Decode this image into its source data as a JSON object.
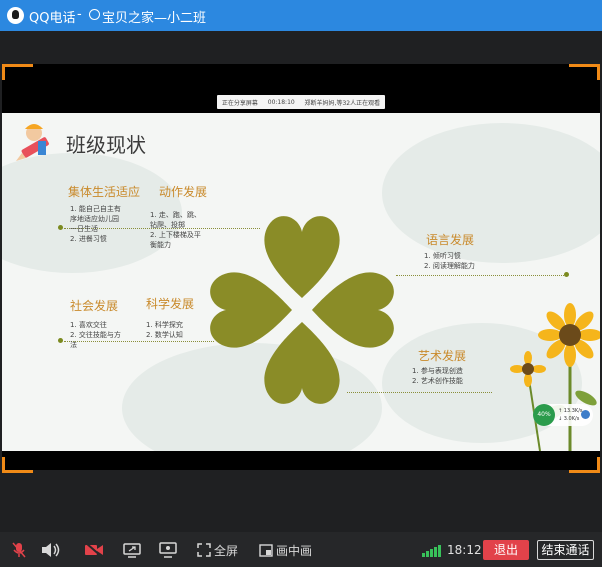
{
  "titlebar": {
    "app_name": "QQ电话",
    "separator": "-",
    "group_name": "宝贝之家—小二班"
  },
  "share_bar": {
    "status": "正在分享屏幕",
    "duration": "00:18:10",
    "viewers": "郑断羊妈妈,等32人正在观看"
  },
  "slide": {
    "title": "班级现状",
    "sections": {
      "collective": {
        "heading": "集体生活适应",
        "items": [
          "1. 能自己自主有",
          "序地适应幼儿园",
          "一日生活",
          "2. 进餐习惯"
        ]
      },
      "motor": {
        "heading": "动作发展",
        "items": [
          "1. 走、跑、跳、",
          "钻爬、投掷",
          "2. 上下楼梯及平",
          "衡能力"
        ]
      },
      "language": {
        "heading": "语言发展",
        "items": [
          "1. 倾听习惯",
          "2. 阅读理解能力"
        ]
      },
      "social": {
        "heading": "社会发展",
        "items": [
          "1. 喜欢交往",
          "2. 交往技能与方",
          "法"
        ]
      },
      "science": {
        "heading": "科学发展",
        "items": [
          "1. 科学探究",
          "2. 数学认知"
        ]
      },
      "art": {
        "heading": "艺术发展",
        "items": [
          "1. 参与表现创造",
          "2. 艺术创作技能"
        ]
      }
    },
    "net_badge": {
      "percent": "40%",
      "upload": "↑ 13.3K/s",
      "download": "↓ 3.0K/s"
    }
  },
  "toolbar": {
    "fullscreen_label": "全屏",
    "pip_label": "画中画",
    "time": "18:12",
    "exit_label": "退出",
    "end_call_label": "结束通话"
  },
  "colors": {
    "titlebar": "#2c88e0",
    "accent_orange": "#f08a17",
    "clover": "#8a8c27",
    "exit_red": "#e2424a"
  }
}
